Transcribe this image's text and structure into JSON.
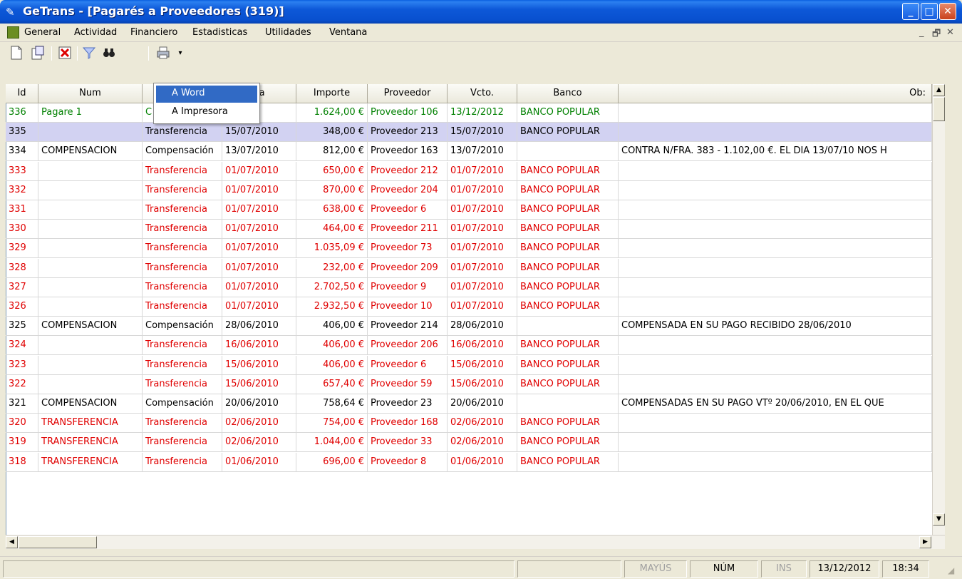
{
  "window": {
    "title": "GeTrans - [Pagarés a Proveedores (319)]",
    "minimize": "_",
    "maximize": "□",
    "close": "✕"
  },
  "menu": {
    "items": [
      "General",
      "Actividad",
      "Financiero",
      "Estadisticas",
      "Utilidades",
      "Ventana"
    ],
    "mdi_min": "_",
    "mdi_restore": "🗗",
    "mdi_close": "✕"
  },
  "toolbar": {
    "icons": [
      "new-icon",
      "properties-icon",
      "delete-icon",
      "filter-icon",
      "search-binoculars-icon",
      "print-icon",
      "dropdown-arrow-icon"
    ]
  },
  "dropdown": {
    "items": [
      "A Word",
      "A Impresora"
    ],
    "active_index": 0
  },
  "grid": {
    "columns": [
      "Id",
      "Num",
      "",
      "ha",
      "Importe",
      "Proveedor",
      "Vcto.",
      "Banco",
      "Ob:"
    ],
    "rows": [
      {
        "id": "336",
        "num": "Pagare 1",
        "tipo": "C",
        "fecha": "/2012",
        "importe": "1.624,00 €",
        "proveedor": "Proveedor 106",
        "vcto": "13/12/2012",
        "banco": "BANCO POPULAR",
        "obs": "",
        "color": "#008000"
      },
      {
        "id": "335",
        "num": "",
        "tipo": "Transferencia",
        "fecha": "15/07/2010",
        "importe": "348,00 €",
        "proveedor": "Proveedor 213",
        "vcto": "15/07/2010",
        "banco": "BANCO POPULAR",
        "obs": "",
        "color": "#000000"
      },
      {
        "id": "334",
        "num": "COMPENSACION",
        "tipo": "Compensación",
        "fecha": "13/07/2010",
        "importe": "812,00 €",
        "proveedor": "Proveedor 163",
        "vcto": "13/07/2010",
        "banco": "",
        "obs": "CONTRA N/FRA. 383 - 1.102,00 €. EL DIA 13/07/10 NOS H",
        "color": "#000000"
      },
      {
        "id": "333",
        "num": "",
        "tipo": "Transferencia",
        "fecha": "01/07/2010",
        "importe": "650,00 €",
        "proveedor": "Proveedor 212",
        "vcto": "01/07/2010",
        "banco": "BANCO POPULAR",
        "obs": "",
        "color": "#e00000"
      },
      {
        "id": "332",
        "num": "",
        "tipo": "Transferencia",
        "fecha": "01/07/2010",
        "importe": "870,00 €",
        "proveedor": "Proveedor 204",
        "vcto": "01/07/2010",
        "banco": "BANCO POPULAR",
        "obs": "",
        "color": "#e00000"
      },
      {
        "id": "331",
        "num": "",
        "tipo": "Transferencia",
        "fecha": "01/07/2010",
        "importe": "638,00 €",
        "proveedor": "Proveedor 6",
        "vcto": "01/07/2010",
        "banco": "BANCO POPULAR",
        "obs": "",
        "color": "#e00000"
      },
      {
        "id": "330",
        "num": "",
        "tipo": "Transferencia",
        "fecha": "01/07/2010",
        "importe": "464,00 €",
        "proveedor": "Proveedor 211",
        "vcto": "01/07/2010",
        "banco": "BANCO POPULAR",
        "obs": "",
        "color": "#e00000"
      },
      {
        "id": "329",
        "num": "",
        "tipo": "Transferencia",
        "fecha": "01/07/2010",
        "importe": "1.035,09 €",
        "proveedor": "Proveedor 73",
        "vcto": "01/07/2010",
        "banco": "BANCO POPULAR",
        "obs": "",
        "color": "#e00000"
      },
      {
        "id": "328",
        "num": "",
        "tipo": "Transferencia",
        "fecha": "01/07/2010",
        "importe": "232,00 €",
        "proveedor": "Proveedor 209",
        "vcto": "01/07/2010",
        "banco": "BANCO POPULAR",
        "obs": "",
        "color": "#e00000"
      },
      {
        "id": "327",
        "num": "",
        "tipo": "Transferencia",
        "fecha": "01/07/2010",
        "importe": "2.702,50 €",
        "proveedor": "Proveedor 9",
        "vcto": "01/07/2010",
        "banco": "BANCO POPULAR",
        "obs": "",
        "color": "#e00000"
      },
      {
        "id": "326",
        "num": "",
        "tipo": "Transferencia",
        "fecha": "01/07/2010",
        "importe": "2.932,50 €",
        "proveedor": "Proveedor 10",
        "vcto": "01/07/2010",
        "banco": "BANCO POPULAR",
        "obs": "",
        "color": "#e00000"
      },
      {
        "id": "325",
        "num": "COMPENSACION",
        "tipo": "Compensación",
        "fecha": "28/06/2010",
        "importe": "406,00 €",
        "proveedor": "Proveedor 214",
        "vcto": "28/06/2010",
        "banco": "",
        "obs": "COMPENSADA EN SU PAGO RECIBIDO 28/06/2010",
        "color": "#000000"
      },
      {
        "id": "324",
        "num": "",
        "tipo": "Transferencia",
        "fecha": "16/06/2010",
        "importe": "406,00 €",
        "proveedor": "Proveedor 206",
        "vcto": "16/06/2010",
        "banco": "BANCO POPULAR",
        "obs": "",
        "color": "#e00000"
      },
      {
        "id": "323",
        "num": "",
        "tipo": "Transferencia",
        "fecha": "15/06/2010",
        "importe": "406,00 €",
        "proveedor": "Proveedor 6",
        "vcto": "15/06/2010",
        "banco": "BANCO POPULAR",
        "obs": "",
        "color": "#e00000"
      },
      {
        "id": "322",
        "num": "",
        "tipo": "Transferencia",
        "fecha": "15/06/2010",
        "importe": "657,40 €",
        "proveedor": "Proveedor 59",
        "vcto": "15/06/2010",
        "banco": "BANCO POPULAR",
        "obs": "",
        "color": "#e00000"
      },
      {
        "id": "321",
        "num": "COMPENSACION",
        "tipo": "Compensación",
        "fecha": "20/06/2010",
        "importe": "758,64 €",
        "proveedor": "Proveedor 23",
        "vcto": "20/06/2010",
        "banco": "",
        "obs": "COMPENSADAS EN SU PAGO VTº 20/06/2010, EN EL QUE",
        "color": "#000000"
      },
      {
        "id": "320",
        "num": "TRANSFERENCIA",
        "tipo": "Transferencia",
        "fecha": "02/06/2010",
        "importe": "754,00 €",
        "proveedor": "Proveedor 168",
        "vcto": "02/06/2010",
        "banco": "BANCO POPULAR",
        "obs": "",
        "color": "#e00000"
      },
      {
        "id": "319",
        "num": "TRANSFERENCIA",
        "tipo": "Transferencia",
        "fecha": "02/06/2010",
        "importe": "1.044,00 €",
        "proveedor": "Proveedor 33",
        "vcto": "02/06/2010",
        "banco": "BANCO POPULAR",
        "obs": "",
        "color": "#e00000"
      },
      {
        "id": "318",
        "num": "TRANSFERENCIA",
        "tipo": "Transferencia",
        "fecha": "01/06/2010",
        "importe": "696,00 €",
        "proveedor": "Proveedor 8",
        "vcto": "01/06/2010",
        "banco": "BANCO POPULAR",
        "obs": "",
        "color": "#e00000"
      }
    ],
    "selected_index": 1
  },
  "status": {
    "mayus": "MAYÚS",
    "num": "NÚM",
    "ins": "INS",
    "date": "13/12/2012",
    "time": "18:34"
  },
  "colors": {
    "accent": "#316ac5",
    "green": "#008000",
    "red": "#e00000",
    "selected_row": "#d2d2f2"
  }
}
